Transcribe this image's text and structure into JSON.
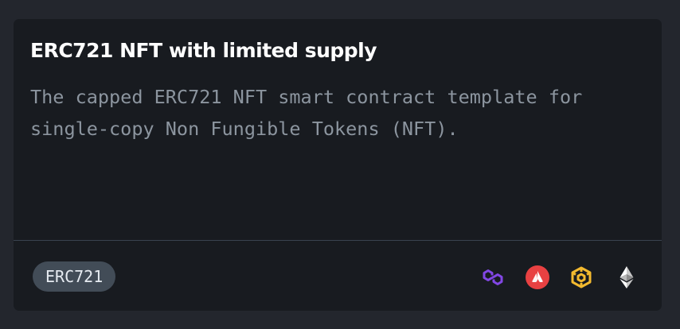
{
  "card": {
    "title": "ERC721 NFT with limited supply",
    "description": "The capped ERC721 NFT smart contract template for single-copy Non Fungible Tokens (NFT).",
    "tag": "ERC721",
    "chains": [
      {
        "icon": "polygon-icon",
        "color": "#8247e5"
      },
      {
        "icon": "avalanche-icon",
        "color": "#e84142"
      },
      {
        "icon": "bnb-icon",
        "color": "#f3ba2f"
      },
      {
        "icon": "ethereum-icon",
        "color": "#ffffff"
      }
    ]
  }
}
